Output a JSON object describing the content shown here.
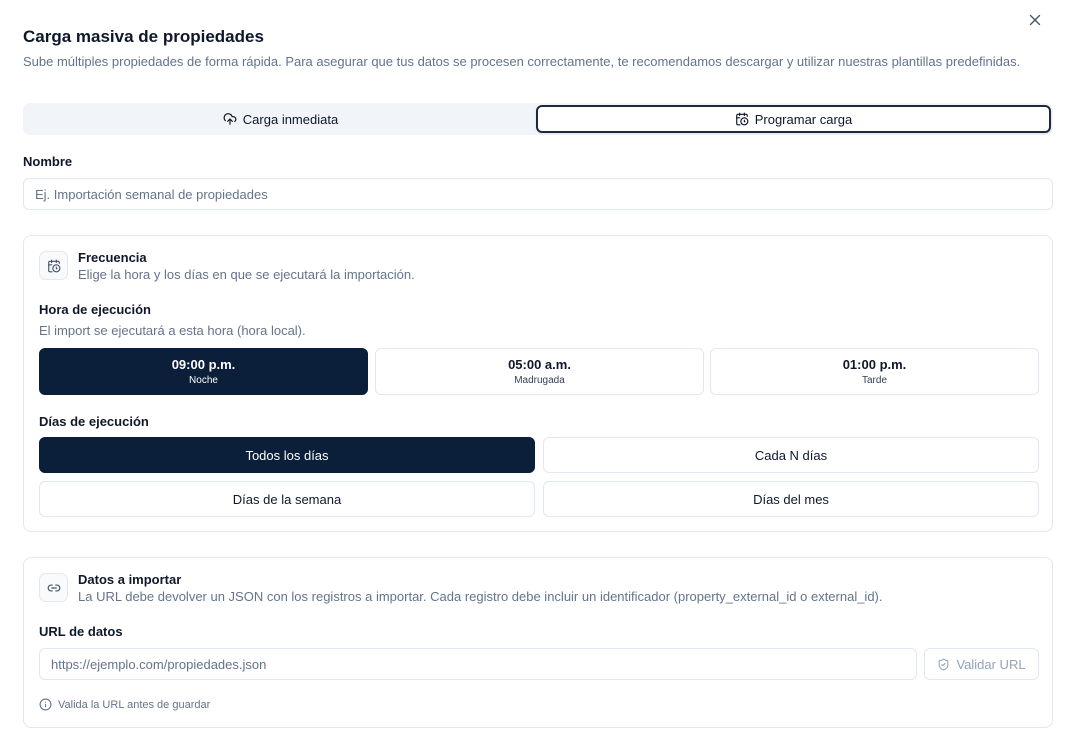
{
  "dialog": {
    "title": "Carga masiva de propiedades",
    "subtitle": "Sube múltiples propiedades de forma rápida. Para asegurar que tus datos se procesen correctamente, te recomendamos descargar y utilizar nuestras plantillas predefinidas."
  },
  "tabs": [
    {
      "label": "Carga inmediata",
      "icon": "cloud-upload-icon",
      "active": false
    },
    {
      "label": "Programar carga",
      "icon": "calendar-clock-icon",
      "active": true
    }
  ],
  "name_field": {
    "label": "Nombre",
    "placeholder": "Ej. Importación semanal de propiedades",
    "value": ""
  },
  "frequency": {
    "title": "Frecuencia",
    "description": "Elige la hora y los días en que se ejecutará la importación.",
    "icon": "calendar-clock-icon",
    "time_label": "Hora de ejecución",
    "time_help": "El import se ejecutará a esta hora (hora local).",
    "time_options": [
      {
        "time": "09:00 p.m.",
        "period": "Noche",
        "selected": true
      },
      {
        "time": "05:00 a.m.",
        "period": "Madrugada",
        "selected": false
      },
      {
        "time": "01:00 p.m.",
        "period": "Tarde",
        "selected": false
      }
    ],
    "days_label": "Días de ejecución",
    "day_options": [
      {
        "label": "Todos los días",
        "selected": true
      },
      {
        "label": "Cada N días",
        "selected": false
      },
      {
        "label": "Días de la semana",
        "selected": false
      },
      {
        "label": "Días del mes",
        "selected": false
      }
    ]
  },
  "data_import": {
    "title": "Datos a importar",
    "description": "La URL debe devolver un JSON con los registros a importar. Cada registro debe incluir un identificador (property_external_id o external_id).",
    "icon": "link-icon",
    "url_label": "URL de datos",
    "url_placeholder": "https://ejemplo.com/propiedades.json",
    "url_value": "",
    "validate_label": "Validar URL",
    "hint": "Valida la URL antes de guardar"
  },
  "colors": {
    "primary_dark": "#0b1f3a",
    "border": "#e2e8f0",
    "muted_text": "#64748b"
  }
}
